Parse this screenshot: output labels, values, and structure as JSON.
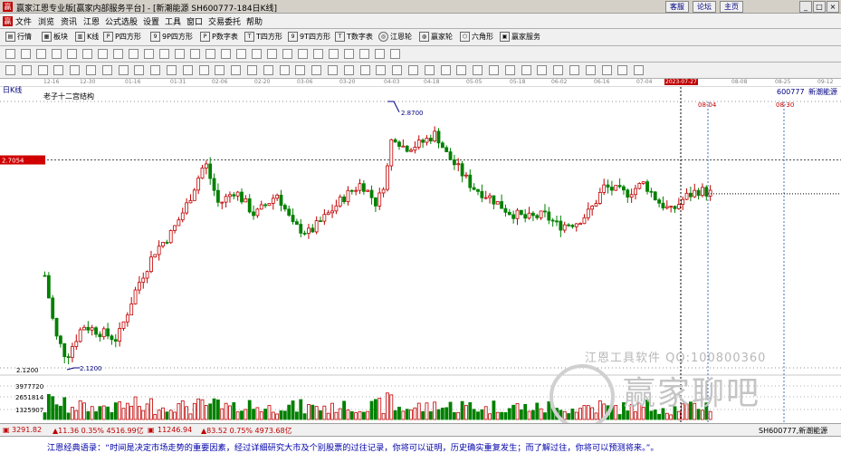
{
  "window": {
    "title": "赢家江恩专业版[赢家内部服务平台] - [新潮能源  SH600777-184日K线]",
    "links": [
      "客服",
      "论坛",
      "主页"
    ]
  },
  "menu": [
    "文件",
    "浏览",
    "资讯",
    "江恩",
    "公式选股",
    "设置",
    "工具",
    "窗口",
    "交易委托",
    "帮助"
  ],
  "toolbar1": [
    "行情",
    "板块",
    "K线",
    "P四方形",
    "9P四方形",
    "P数字表",
    "T四方形",
    "9T四方形",
    "T数字表",
    "江恩轮",
    "赢家轮",
    "六角形",
    "赢家服务"
  ],
  "chart": {
    "period_label": "日K线",
    "indicator_label": "老子十二宫结构",
    "stock_code": "600777",
    "stock_name": "新潮能源",
    "current_price": "2.7054",
    "peak_label": "2.8700",
    "low_label": "2.1200",
    "low_axis_label": "2.1200",
    "volume_labels": [
      "3977720",
      "2651814",
      "1325907"
    ],
    "cursor_date": "2023-07-27",
    "future_dates": [
      "08-04",
      "08-30"
    ],
    "axis_dates": [
      "12-16",
      "12-30",
      "01-16",
      "01-31",
      "02-06",
      "02-20",
      "03-06",
      "03-20",
      "04-03",
      "04-18",
      "05-05",
      "05-18",
      "06-02",
      "06-16",
      "07-04",
      "07-18",
      "08-08",
      "08-25",
      "09-12"
    ]
  },
  "chart_data": {
    "type": "candlestick",
    "title": "老子十二宫结构",
    "y_labels": {
      "last": 2.7054,
      "high": 2.87,
      "low": 2.12
    },
    "high_marker": 2.87,
    "low_marker": 2.12,
    "volume_axis": [
      3977720,
      2651814,
      1325907
    ]
  },
  "status": {
    "sh_index": "3291.82",
    "sh_change": "▲11.36 0.35% 4516.99亿",
    "sz_index": "11246.94",
    "sz_change": "▲83.52 0.75% 4973.68亿",
    "right": "SH600777,新潮能源"
  },
  "quote": "江恩经典语录：“时间是决定市场走势的重要因素，经过详细研究大市及个别股票的过往记录，你将可以证明，历史确实重复发生；而了解过往，你将可以预测将来。”。",
  "watermark": {
    "line1": "江恩工具软件  QQ:100800360",
    "line2": "赢家聊吧"
  },
  "colors": {
    "up": "#c00000",
    "down": "#008000",
    "grid": "#b0b0b0",
    "price_tag": "#d00000"
  }
}
